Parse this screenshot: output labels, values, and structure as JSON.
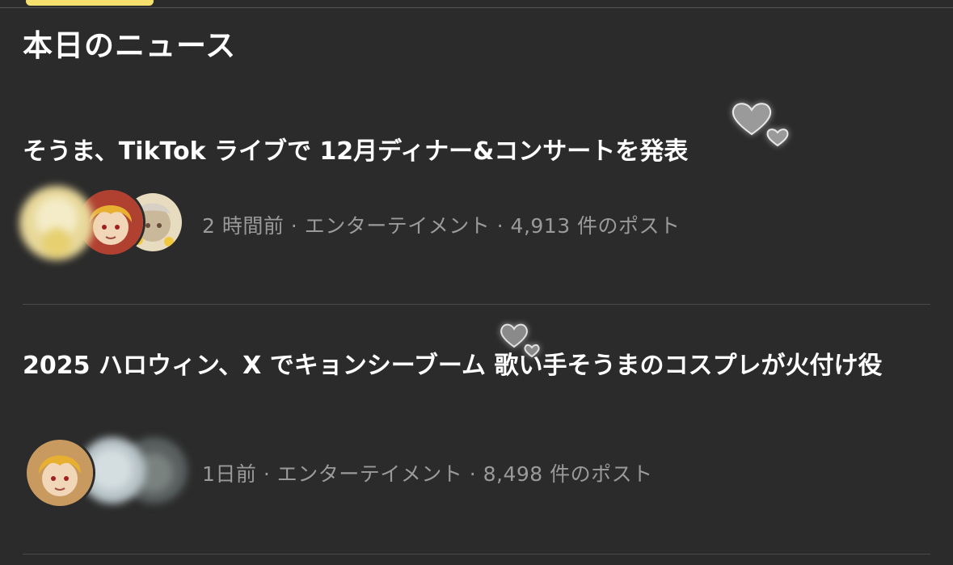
{
  "header": {
    "section_title": "本日のニュース"
  },
  "news": [
    {
      "headline": "そうま、TikTok ライブで 12月ディナー&コンサートを発表",
      "meta": "2 時間前 · エンターテイメント · 4,913 件のポスト"
    },
    {
      "headline": "2025 ハロウィン、X でキョンシーブーム 歌い手そうまのコスプレが火付け役",
      "meta": "1日前 · エンターテイメント · 8,498 件のポスト"
    }
  ],
  "colors": {
    "background": "#2b2b2b",
    "tab_indicator": "#f5e06e",
    "meta_text": "#9a9a9a",
    "divider": "#4a4a4a"
  },
  "icons": {
    "heart_decoration": "heart-icon"
  }
}
